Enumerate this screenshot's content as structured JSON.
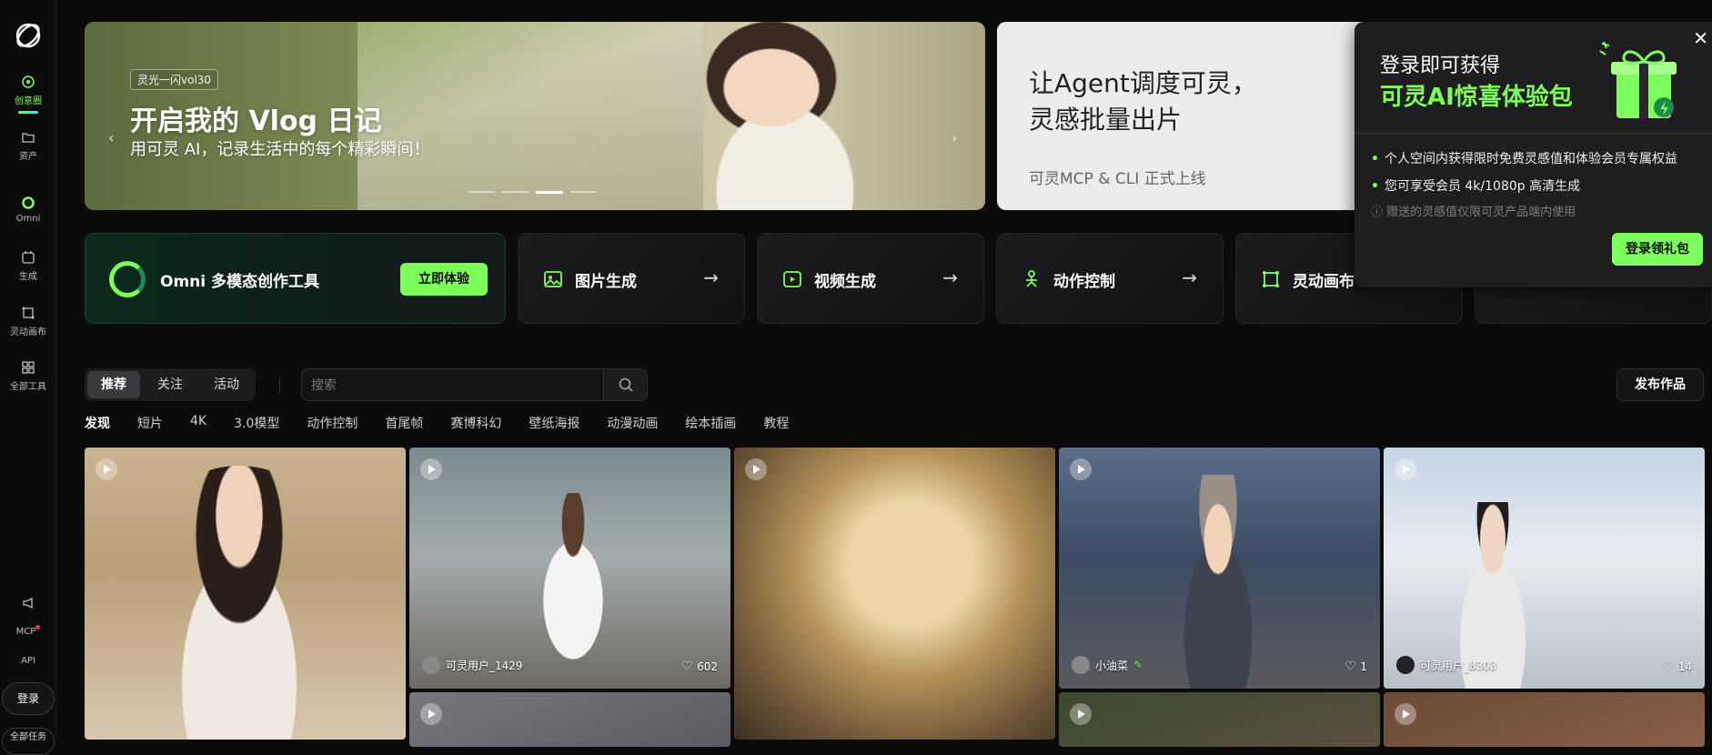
{
  "sidebar": {
    "items": [
      {
        "label": "创意圈",
        "icon": "compass-icon"
      },
      {
        "label": "资产",
        "icon": "folder-icon"
      },
      {
        "label": "Omni",
        "icon": "omni-ring-icon"
      },
      {
        "label": "生成",
        "icon": "generate-icon"
      },
      {
        "label": "灵动画布",
        "icon": "canvas-icon"
      },
      {
        "label": "全部工具",
        "icon": "grid-icon"
      }
    ],
    "bottom": {
      "mcp": "MCP",
      "api": "API",
      "login": "登录",
      "more": "全部任务"
    }
  },
  "banner": {
    "tag": "灵光一闪vol30",
    "title": "开启我的 Vlog 日记",
    "subtitle": "用可灵 AI，记录生活中的每个精彩瞬间！",
    "prev": "‹",
    "next": "›"
  },
  "banner2": {
    "line1": "让Agent调度可灵，",
    "line2": "灵感批量出片",
    "line3": "可灵MCP & CLI 正式上线"
  },
  "popup": {
    "title": "登录即可获得",
    "highlight": "可灵AI惊喜体验包",
    "bullets": [
      "个人空间内获得限时免费灵感值和体验会员专属权益",
      "您可享受会员 4k/1080p 高清生成"
    ],
    "note": "ⓘ 赠送的灵感值仅限可灵产品端内使用",
    "button": "登录领礼包",
    "close": "✕"
  },
  "tools": [
    {
      "label": "Omni 多模态创作工具",
      "cta": "立即体验"
    },
    {
      "label": "图片生成",
      "arrow": "→"
    },
    {
      "label": "视频生成",
      "arrow": "→"
    },
    {
      "label": "动作控制",
      "arrow": "→"
    },
    {
      "label": "灵动画布",
      "arrow": "→"
    }
  ],
  "feed_tabs": [
    "推荐",
    "关注",
    "活动"
  ],
  "search": {
    "placeholder": "搜索"
  },
  "publish": "发布作品",
  "categories": [
    "发现",
    "短片",
    "4K",
    "3.0模型",
    "动作控制",
    "首尾帧",
    "赛博科幻",
    "壁纸海报",
    "动漫动画",
    "绘本插画",
    "教程"
  ],
  "cards": [
    {
      "user": "",
      "likes": ""
    },
    {
      "user": "可灵用户_1429",
      "likes": "602"
    },
    {
      "user": "",
      "likes": ""
    },
    {
      "user": "小油菜",
      "likes": "1"
    },
    {
      "user": "可灵用户_8303",
      "likes": "14"
    }
  ],
  "colors": {
    "accent": "#7dff5c",
    "background": "#0b0b0c"
  }
}
